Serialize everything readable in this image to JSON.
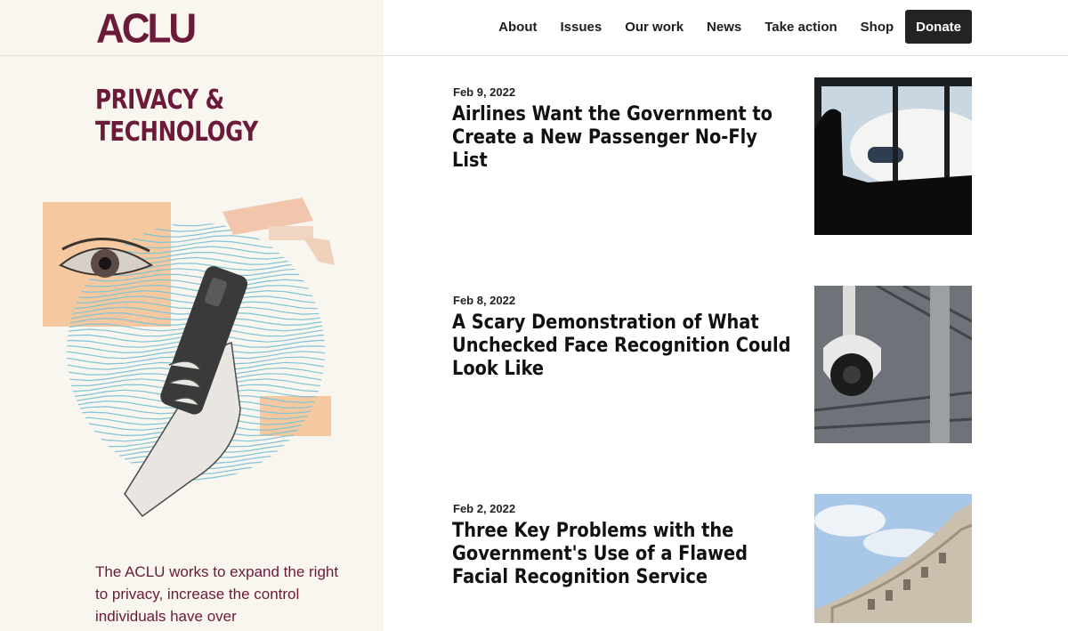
{
  "header": {
    "logo_text": "ACLU",
    "nav": [
      "About",
      "Issues",
      "Our work",
      "News",
      "Take action",
      "Shop"
    ],
    "donate_label": "Donate"
  },
  "sidebar": {
    "title_line1": "PRIVACY &",
    "title_line2": "TECHNOLOGY",
    "intro": "The ACLU works to expand the right to privacy, increase the control individuals have over"
  },
  "articles": [
    {
      "date": "Feb 9, 2022",
      "title": "Airlines Want the Government to Create a New Passenger No-Fly List",
      "image": "airport-window-photo"
    },
    {
      "date": "Feb 8, 2022",
      "title": "A Scary Demonstration of What Unchecked Face Recognition Could Look Like",
      "image": "security-camera-photo"
    },
    {
      "date": "Feb 2, 2022",
      "title": "Three Key Problems with the Government's Use of a Flawed Facial Recognition Service",
      "image": "government-building-photo"
    }
  ],
  "colors": {
    "brand": "#6b1a3a",
    "sidebar_bg": "#f9f5ef",
    "accent_peach": "#f6c89f",
    "accent_blue": "#7ec3d6"
  }
}
